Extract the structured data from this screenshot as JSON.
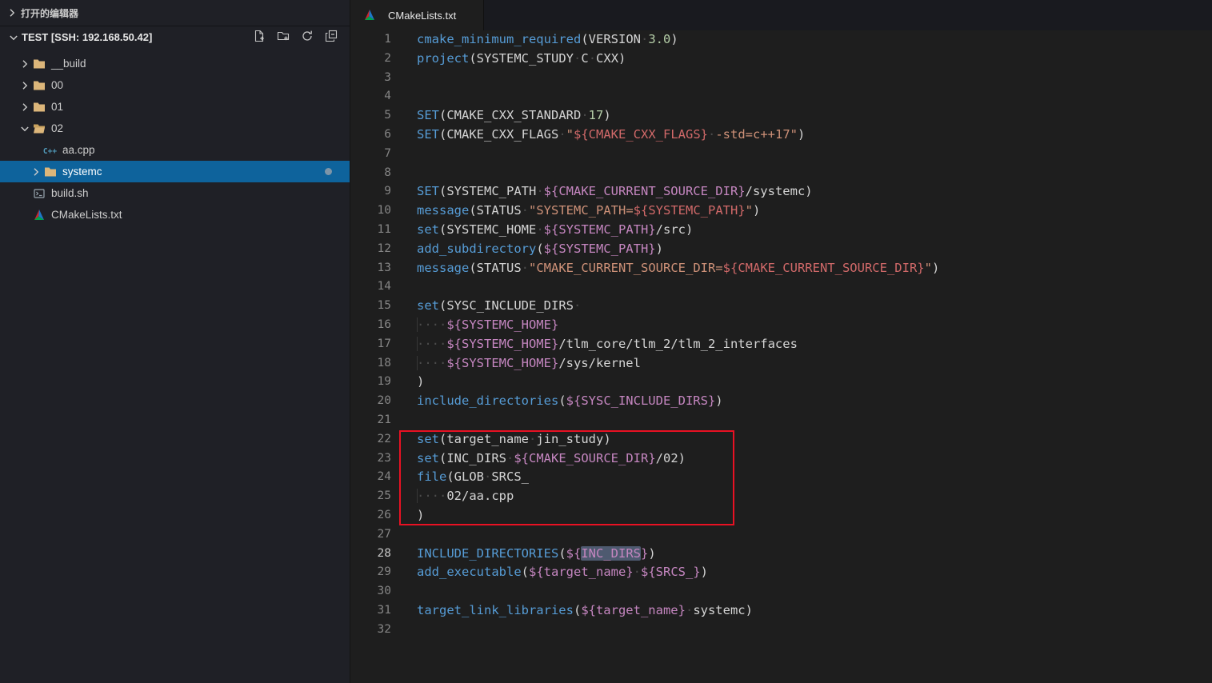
{
  "colors": {
    "selection_blue": "#0e639c",
    "annotation_red": "#e81123",
    "folder_icon": "#dcb67a"
  },
  "sidebar": {
    "open_editors_label": "打开的编辑器",
    "section_title": "TEST [SSH: 192.168.50.42]",
    "actions": [
      {
        "icon": "new-file-icon"
      },
      {
        "icon": "new-folder-icon"
      },
      {
        "icon": "refresh-icon"
      },
      {
        "icon": "collapse-all-icon"
      }
    ],
    "tree": [
      {
        "label": "__build",
        "icon": "folder-icon",
        "type": "folder",
        "state": "collapsed",
        "indent": 1
      },
      {
        "label": "00",
        "icon": "folder-icon",
        "type": "folder",
        "state": "collapsed",
        "indent": 1
      },
      {
        "label": "01",
        "icon": "folder-icon",
        "type": "folder",
        "state": "collapsed",
        "indent": 1
      },
      {
        "label": "02",
        "icon": "folder-open-icon",
        "type": "folder",
        "state": "expanded",
        "indent": 1
      },
      {
        "label": "aa.cpp",
        "icon": "cpp-file-icon",
        "type": "file",
        "indent": 2
      },
      {
        "label": "systemc",
        "icon": "folder-icon",
        "type": "folder",
        "state": "collapsed",
        "indent": 2,
        "selected": true,
        "has_dot": true
      },
      {
        "label": "build.sh",
        "icon": "shell-file-icon",
        "type": "file",
        "indent": 1
      },
      {
        "label": "CMakeLists.txt",
        "icon": "cmake-file-icon",
        "type": "file",
        "indent": 1
      }
    ]
  },
  "tab": {
    "label": "CMakeLists.txt",
    "icon": "cmake-file-icon"
  },
  "editor": {
    "language": "cmake",
    "active_line": 28,
    "annotation": {
      "kind": "red-box",
      "covers_lines": "22-26"
    },
    "lines": [
      [
        [
          "k",
          "cmake_minimum_required"
        ],
        [
          "p",
          "("
        ],
        [
          "p",
          "VERSION"
        ],
        [
          "w",
          "·"
        ],
        [
          "n",
          "3.0"
        ],
        [
          "p",
          ")"
        ]
      ],
      [
        [
          "k",
          "project"
        ],
        [
          "p",
          "("
        ],
        [
          "p",
          "SYSTEMC_STUDY"
        ],
        [
          "w",
          "·"
        ],
        [
          "p",
          "C"
        ],
        [
          "w",
          "·"
        ],
        [
          "p",
          "CXX"
        ],
        [
          "p",
          ")"
        ]
      ],
      [],
      [],
      [
        [
          "k",
          "SET"
        ],
        [
          "p",
          "("
        ],
        [
          "p",
          "CMAKE_CXX_STANDARD"
        ],
        [
          "w",
          "·"
        ],
        [
          "n",
          "17"
        ],
        [
          "p",
          ")"
        ]
      ],
      [
        [
          "k",
          "SET"
        ],
        [
          "p",
          "("
        ],
        [
          "p",
          "CMAKE_CXX_FLAGS"
        ],
        [
          "w",
          "·"
        ],
        [
          "s",
          "\""
        ],
        [
          "sv",
          "${CMAKE_CXX_FLAGS}"
        ],
        [
          "w",
          "·"
        ],
        [
          "s",
          "-std=c++17\""
        ],
        [
          "p",
          ")"
        ]
      ],
      [],
      [],
      [
        [
          "k",
          "SET"
        ],
        [
          "p",
          "("
        ],
        [
          "p",
          "SYSTEMC_PATH"
        ],
        [
          "w",
          "·"
        ],
        [
          "v",
          "${CMAKE_CURRENT_SOURCE_DIR}"
        ],
        [
          "p",
          "/systemc"
        ],
        [
          "p",
          ")"
        ]
      ],
      [
        [
          "k",
          "message"
        ],
        [
          "p",
          "("
        ],
        [
          "p",
          "STATUS"
        ],
        [
          "w",
          "·"
        ],
        [
          "s",
          "\"SYSTEMC_PATH="
        ],
        [
          "sv",
          "${SYSTEMC_PATH}"
        ],
        [
          "s",
          "\""
        ],
        [
          "p",
          ")"
        ]
      ],
      [
        [
          "k",
          "set"
        ],
        [
          "p",
          "("
        ],
        [
          "p",
          "SYSTEMC_HOME"
        ],
        [
          "w",
          "·"
        ],
        [
          "v",
          "${SYSTEMC_PATH}"
        ],
        [
          "p",
          "/src"
        ],
        [
          "p",
          ")"
        ]
      ],
      [
        [
          "k",
          "add_subdirectory"
        ],
        [
          "p",
          "("
        ],
        [
          "v",
          "${SYSTEMC_PATH}"
        ],
        [
          "p",
          ")"
        ]
      ],
      [
        [
          "k",
          "message"
        ],
        [
          "p",
          "("
        ],
        [
          "p",
          "STATUS"
        ],
        [
          "w",
          "·"
        ],
        [
          "s",
          "\"CMAKE_CURRENT_SOURCE_DIR="
        ],
        [
          "sv",
          "${CMAKE_CURRENT_SOURCE_DIR}"
        ],
        [
          "s",
          "\""
        ],
        [
          "p",
          ")"
        ]
      ],
      [],
      [
        [
          "k",
          "set"
        ],
        [
          "p",
          "("
        ],
        [
          "p",
          "SYSC_INCLUDE_DIRS"
        ],
        [
          "w",
          "·"
        ]
      ],
      [
        [
          "g",
          "····"
        ],
        [
          "v",
          "${SYSTEMC_HOME}"
        ]
      ],
      [
        [
          "g",
          "····"
        ],
        [
          "v",
          "${SYSTEMC_HOME}"
        ],
        [
          "p",
          "/tlm_core/tlm_2/tlm_2_interfaces"
        ]
      ],
      [
        [
          "g",
          "····"
        ],
        [
          "v",
          "${SYSTEMC_HOME}"
        ],
        [
          "p",
          "/sys/kernel"
        ]
      ],
      [
        [
          "p",
          ")"
        ]
      ],
      [
        [
          "k",
          "include_directories"
        ],
        [
          "p",
          "("
        ],
        [
          "v",
          "${SYSC_INCLUDE_DIRS}"
        ],
        [
          "p",
          ")"
        ]
      ],
      [],
      [
        [
          "k",
          "set"
        ],
        [
          "p",
          "("
        ],
        [
          "p",
          "target_name"
        ],
        [
          "w",
          "·"
        ],
        [
          "p",
          "jin_study"
        ],
        [
          "p",
          ")"
        ]
      ],
      [
        [
          "k",
          "set"
        ],
        [
          "p",
          "("
        ],
        [
          "p",
          "INC_DIRS"
        ],
        [
          "w",
          "·"
        ],
        [
          "v",
          "${CMAKE_SOURCE_DIR}"
        ],
        [
          "p",
          "/02"
        ],
        [
          "p",
          ")"
        ]
      ],
      [
        [
          "k",
          "file"
        ],
        [
          "p",
          "("
        ],
        [
          "p",
          "GLOB"
        ],
        [
          "w",
          "·"
        ],
        [
          "p",
          "SRCS_"
        ]
      ],
      [
        [
          "g",
          "····"
        ],
        [
          "p",
          "02/aa.cpp"
        ]
      ],
      [
        [
          "p",
          ")"
        ]
      ],
      [],
      [
        [
          "k",
          "INCLUDE_DIRECTORIES"
        ],
        [
          "p",
          "("
        ],
        [
          "v",
          "${"
        ],
        [
          "vh",
          "INC_DIRS"
        ],
        [
          "v",
          "}"
        ],
        [
          "p",
          ")"
        ]
      ],
      [
        [
          "k",
          "add_executable"
        ],
        [
          "p",
          "("
        ],
        [
          "v",
          "${target_name}"
        ],
        [
          "w",
          "·"
        ],
        [
          "v",
          "${SRCS_}"
        ],
        [
          "p",
          ")"
        ]
      ],
      [],
      [
        [
          "k",
          "target_link_libraries"
        ],
        [
          "p",
          "("
        ],
        [
          "v",
          "${target_name}"
        ],
        [
          "w",
          "·"
        ],
        [
          "p",
          "systemc"
        ],
        [
          "p",
          ")"
        ]
      ],
      []
    ]
  }
}
